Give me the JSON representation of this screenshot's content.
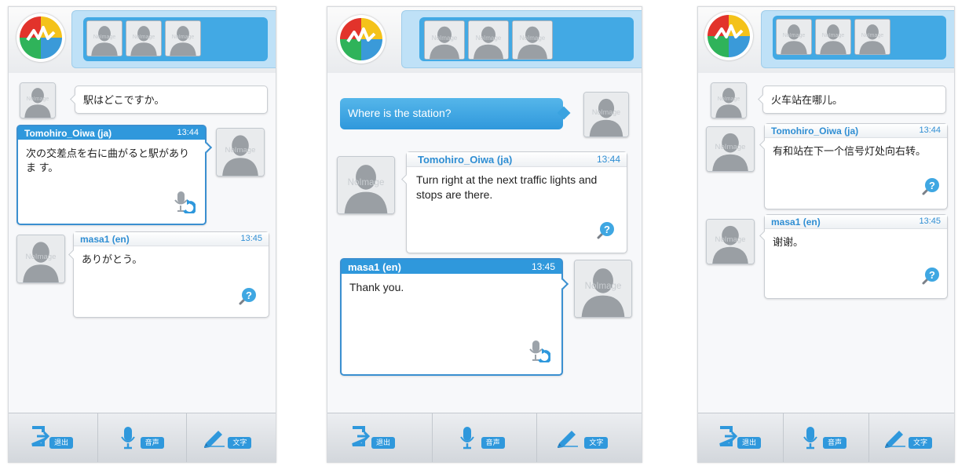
{
  "colors": {
    "accent": "#2f98dc",
    "header_strip": "#42a9e4"
  },
  "avatar_placeholder": "NoImage",
  "toolbar": {
    "exit_label": "退出",
    "voice_label": "音声",
    "text_label": "文字"
  },
  "icons": {
    "exit": "exit-icon",
    "mic": "microphone-icon",
    "pen": "pen-icon",
    "help": "question-icon"
  },
  "screens": [
    {
      "messages": [
        {
          "text": "駅はどこですか。"
        },
        {
          "name": "Tomohiro_Oiwa (ja)",
          "time": "13:44",
          "text": "次の交差点を右に曲がると駅がありま す。"
        },
        {
          "name": "masa1 (en)",
          "time": "13:45",
          "text": "ありがとう。"
        }
      ]
    },
    {
      "messages": [
        {
          "text": "Where is the station?"
        },
        {
          "name": "Tomohiro_Oiwa (ja)",
          "time": "13:44",
          "text": "Turn right at the next traffic lights and stops are there."
        },
        {
          "name": "masa1 (en)",
          "time": "13:45",
          "text": "Thank you."
        }
      ]
    },
    {
      "messages": [
        {
          "text": "火车站在哪儿。"
        },
        {
          "name": "Tomohiro_Oiwa (ja)",
          "time": "13:44",
          "text": "有和站在下一个信号灯处向右转。"
        },
        {
          "name": "masa1 (en)",
          "time": "13:45",
          "text": "谢谢。"
        }
      ]
    }
  ]
}
